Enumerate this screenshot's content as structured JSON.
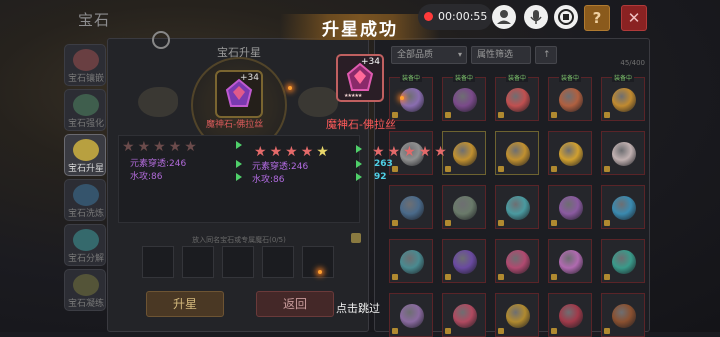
{
  "header": {
    "title": "宝石"
  },
  "sidebar": {
    "items": [
      {
        "label": "宝石镶嵌",
        "icon": "gem-inlay-icon"
      },
      {
        "label": "宝石强化",
        "icon": "gem-enhance-icon"
      },
      {
        "label": "宝石升星",
        "icon": "gem-star-icon"
      },
      {
        "label": "宝石洗炼",
        "icon": "gem-refine-icon"
      },
      {
        "label": "宝石分解",
        "icon": "gem-decompose-icon"
      },
      {
        "label": "宝石凝练",
        "icon": "gem-condense-icon"
      }
    ],
    "active_index": 2
  },
  "upgrade_panel": {
    "title": "宝石升星",
    "gem_level": "+34",
    "gem_name": "魔神石-佛拉丝",
    "old_stars": 5,
    "old_stats": [
      {
        "label": "元素穿透:246"
      },
      {
        "label": "水攻:86"
      }
    ],
    "hint": "放入同名宝石或专属魔石(0/5)",
    "upgrade_button": "升星",
    "back_button": "返回"
  },
  "result": {
    "banner": "升星成功",
    "gem_level": "+34",
    "gem_name": "魔神石-佛拉丝",
    "before_stars": 5,
    "after_stars": 5,
    "stats": [
      {
        "label": "元素穿透:246",
        "new_value": "263"
      },
      {
        "label": "水攻:86",
        "new_value": "92"
      }
    ],
    "skip_text": "点击跳过"
  },
  "inventory": {
    "filter_quality": "全部品质",
    "filter_attr": "属性筛选",
    "capacity": "45/400",
    "equipped_tag": "装备中",
    "cells": [
      {
        "gem": "#8a6db0",
        "equipped": true,
        "gold": false
      },
      {
        "gem": "#7a4a8a",
        "equipped": true,
        "gold": false
      },
      {
        "gem": "#c05050",
        "equipped": true,
        "gold": false
      },
      {
        "gem": "#b06040",
        "equipped": true,
        "gold": false
      },
      {
        "gem": "#c08a30",
        "equipped": true,
        "gold": false
      },
      {
        "gem": "#909090",
        "equipped": false,
        "gold": false
      },
      {
        "gem": "#c09030",
        "equipped": false,
        "gold": true
      },
      {
        "gem": "#c09030",
        "equipped": false,
        "gold": true
      },
      {
        "gem": "#d0a030",
        "equipped": false,
        "gold": false
      },
      {
        "gem": "#c0b0b0",
        "equipped": false,
        "gold": false
      },
      {
        "gem": "#4a6a8a",
        "equipped": false,
        "gold": false
      },
      {
        "gem": "#6a7a6a",
        "equipped": false,
        "gold": false
      },
      {
        "gem": "#4a9aa0",
        "equipped": false,
        "gold": false
      },
      {
        "gem": "#8a5aa0",
        "equipped": false,
        "gold": false
      },
      {
        "gem": "#3a8ab0",
        "equipped": false,
        "gold": false
      },
      {
        "gem": "#4a8a90",
        "equipped": false,
        "gold": false
      },
      {
        "gem": "#6a4aa0",
        "equipped": false,
        "gold": false
      },
      {
        "gem": "#b04a70",
        "equipped": false,
        "gold": false
      },
      {
        "gem": "#b06ab0",
        "equipped": false,
        "gold": false
      },
      {
        "gem": "#3a9a8a",
        "equipped": false,
        "gold": false
      },
      {
        "gem": "#8a6aa0",
        "equipped": false,
        "gold": false
      },
      {
        "gem": "#b04a60",
        "equipped": false,
        "gold": false
      },
      {
        "gem": "#b08a30",
        "equipped": false,
        "gold": false
      },
      {
        "gem": "#a03a4a",
        "equipped": false,
        "gold": false
      },
      {
        "gem": "#8a5030",
        "equipped": false,
        "gold": false
      }
    ]
  },
  "toolbar": {
    "timer": "00:00:55",
    "help": "?",
    "close": "✕"
  }
}
